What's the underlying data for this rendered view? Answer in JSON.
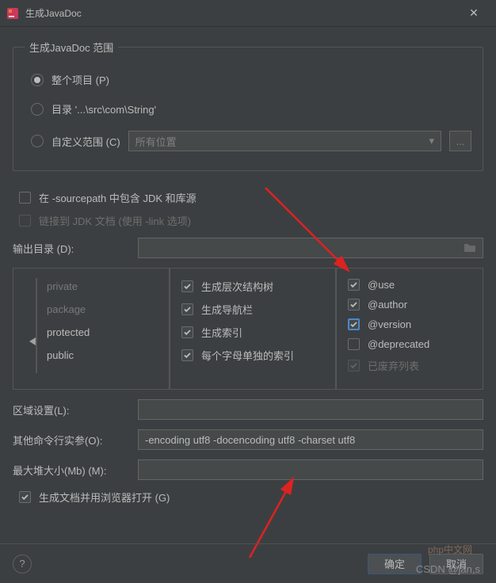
{
  "window": {
    "title": "生成JavaDoc"
  },
  "scope": {
    "legend": "生成JavaDoc 范围",
    "whole_project": "整个项目 (P)",
    "directory": "目录 '...\\src\\com\\String'",
    "custom_scope": "自定义范围 (C)",
    "custom_combo": "所有位置",
    "browse": "..."
  },
  "options": {
    "include_jdk": "在 -sourcepath 中包含 JDK 和库源",
    "link_jdk": "链接到 JDK 文档 (使用 -link 选项)"
  },
  "output": {
    "label": "输出目录 (D):",
    "value": ""
  },
  "visibility": {
    "private": "private",
    "package": "package",
    "protected": "protected",
    "public": "public"
  },
  "gen": {
    "hierarchy": "生成层次结构树",
    "navbar": "生成导航栏",
    "index": "生成索引",
    "split_index": "每个字母单独的索引"
  },
  "tags": {
    "use": "@use",
    "author": "@author",
    "version": "@version",
    "deprecated": "@deprecated",
    "deprecated_list": "已废弃列表"
  },
  "locale": {
    "label": "区域设置(L):",
    "value": ""
  },
  "cli": {
    "label": "其他命令行实参(O):",
    "value": "-encoding utf8 -docencoding utf8 -charset utf8"
  },
  "heap": {
    "label": "最大堆大小(Mb) (M):",
    "value": ""
  },
  "open_browser": "生成文档并用浏览器打开 (G)",
  "buttons": {
    "ok": "确定",
    "cancel": "取消"
  },
  "watermark": "CSDN @jan,s",
  "watermark2": "php中文网"
}
